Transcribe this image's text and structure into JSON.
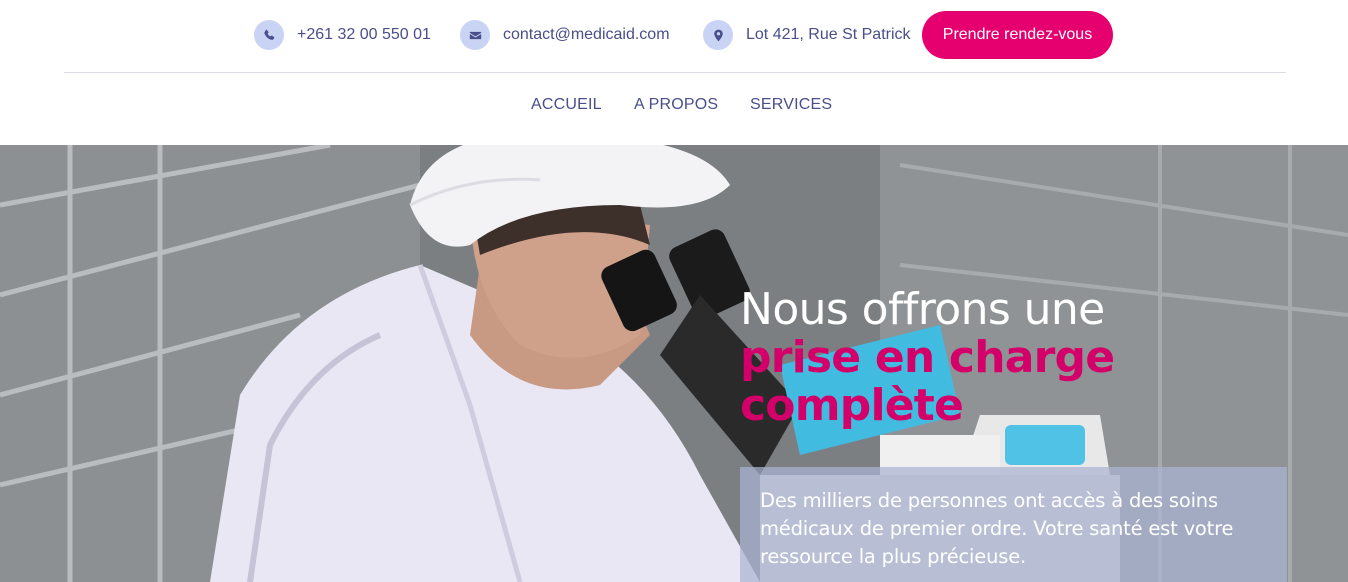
{
  "contact": {
    "phone": {
      "icon": "phone-icon",
      "text": "+261 32 00 550 01"
    },
    "email": {
      "icon": "envelope-icon",
      "text": "contact@medicaid.com"
    },
    "address": {
      "icon": "map-pin-icon",
      "text": "Lot 421, Rue St Patrick"
    }
  },
  "cta": {
    "label": "Prendre rendez-vous",
    "color": "#e6006f"
  },
  "nav": {
    "items": [
      {
        "label": "ACCUEIL"
      },
      {
        "label": "A PROPOS"
      },
      {
        "label": "SERVICES"
      }
    ]
  },
  "hero": {
    "heading_line1": "Nous offrons une",
    "heading_line2": "prise en charge",
    "heading_line3": "complète",
    "description": "Des milliers de personnes ont accès à des soins médicaux de premier ordre. Votre santé est votre ressource la plus précieuse.",
    "accent_color": "#d4006a"
  },
  "colors": {
    "text_primary": "#4a4e8a",
    "icon_bg": "#c9d4f5"
  }
}
